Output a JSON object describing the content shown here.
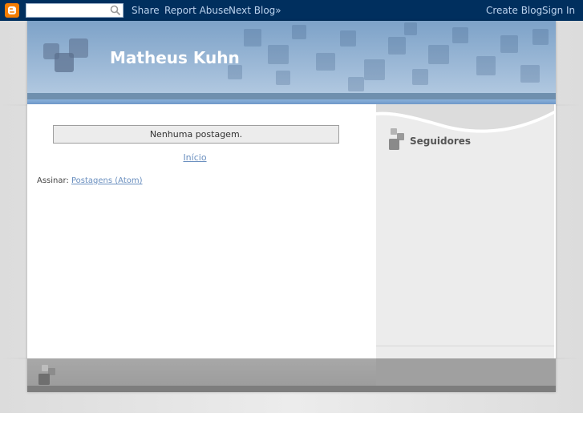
{
  "navbar": {
    "search_placeholder": "",
    "links": {
      "share": "Share",
      "report_abuse": "Report Abuse",
      "next_blog": "Next Blog»",
      "create_blog": "Create Blog",
      "sign_in": "Sign In"
    }
  },
  "header": {
    "title": "Matheus Kuhn"
  },
  "main": {
    "status_message": "Nenhuma postagem.",
    "home_link": "Início",
    "feed_label": "Assinar:",
    "feed_link": "Postagens (Atom)"
  },
  "sidebar": {
    "widget_title": "Seguidores"
  },
  "colors": {
    "navbar": "#002f5e",
    "blogger_orange": "#f57d00",
    "link": "#6a8fbf",
    "header_blue": "#7da2c8",
    "sidebar_bg": "#ececec"
  },
  "icons": [
    "blogger-logo-icon",
    "search-icon",
    "squares-logo-icon"
  ]
}
